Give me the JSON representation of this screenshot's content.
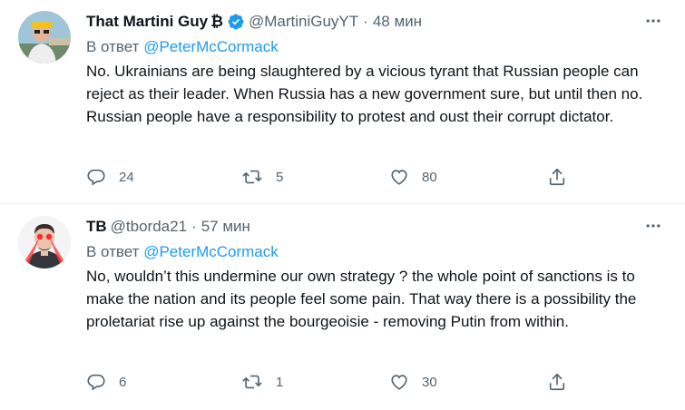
{
  "tweets": [
    {
      "name": "That Martini Guy",
      "name_suffix": "₿",
      "handle": "@MartiniGuyYT",
      "time": "48 мин",
      "reply_prefix": "В ответ",
      "reply_to": "@PeterMcCormack",
      "text": "No. Ukrainians are being slaughtered by a vicious tyrant that Russian people can reject as their leader. When Russia has a new government sure, but until then no. Russian people have a responsibility to protest and oust their corrupt dictator.",
      "replies": "24",
      "retweets": "5",
      "likes": "80",
      "verified": true,
      "icons": [
        "more-icon",
        "reply-icon",
        "retweet-icon",
        "like-icon",
        "share-icon",
        "verified-icon"
      ]
    },
    {
      "name": "TB",
      "handle": "@tborda21",
      "time": "57 мин",
      "reply_prefix": "В ответ",
      "reply_to": "@PeterMcCormack",
      "text": "No, wouldn’t this undermine our own strategy ? the whole point of sanctions is to make the nation and its people feel some pain. That way there is a possibility the proletariat rise up against the bourgeoisie - removing Putin from within.",
      "replies": "6",
      "retweets": "1",
      "likes": "30",
      "verified": false,
      "icons": [
        "more-icon",
        "reply-icon",
        "retweet-icon",
        "like-icon",
        "share-icon"
      ]
    }
  ],
  "colors": {
    "text": "#0f1419",
    "muted": "#536471",
    "link": "#1d9bf0",
    "divider": "#eff3f4"
  }
}
